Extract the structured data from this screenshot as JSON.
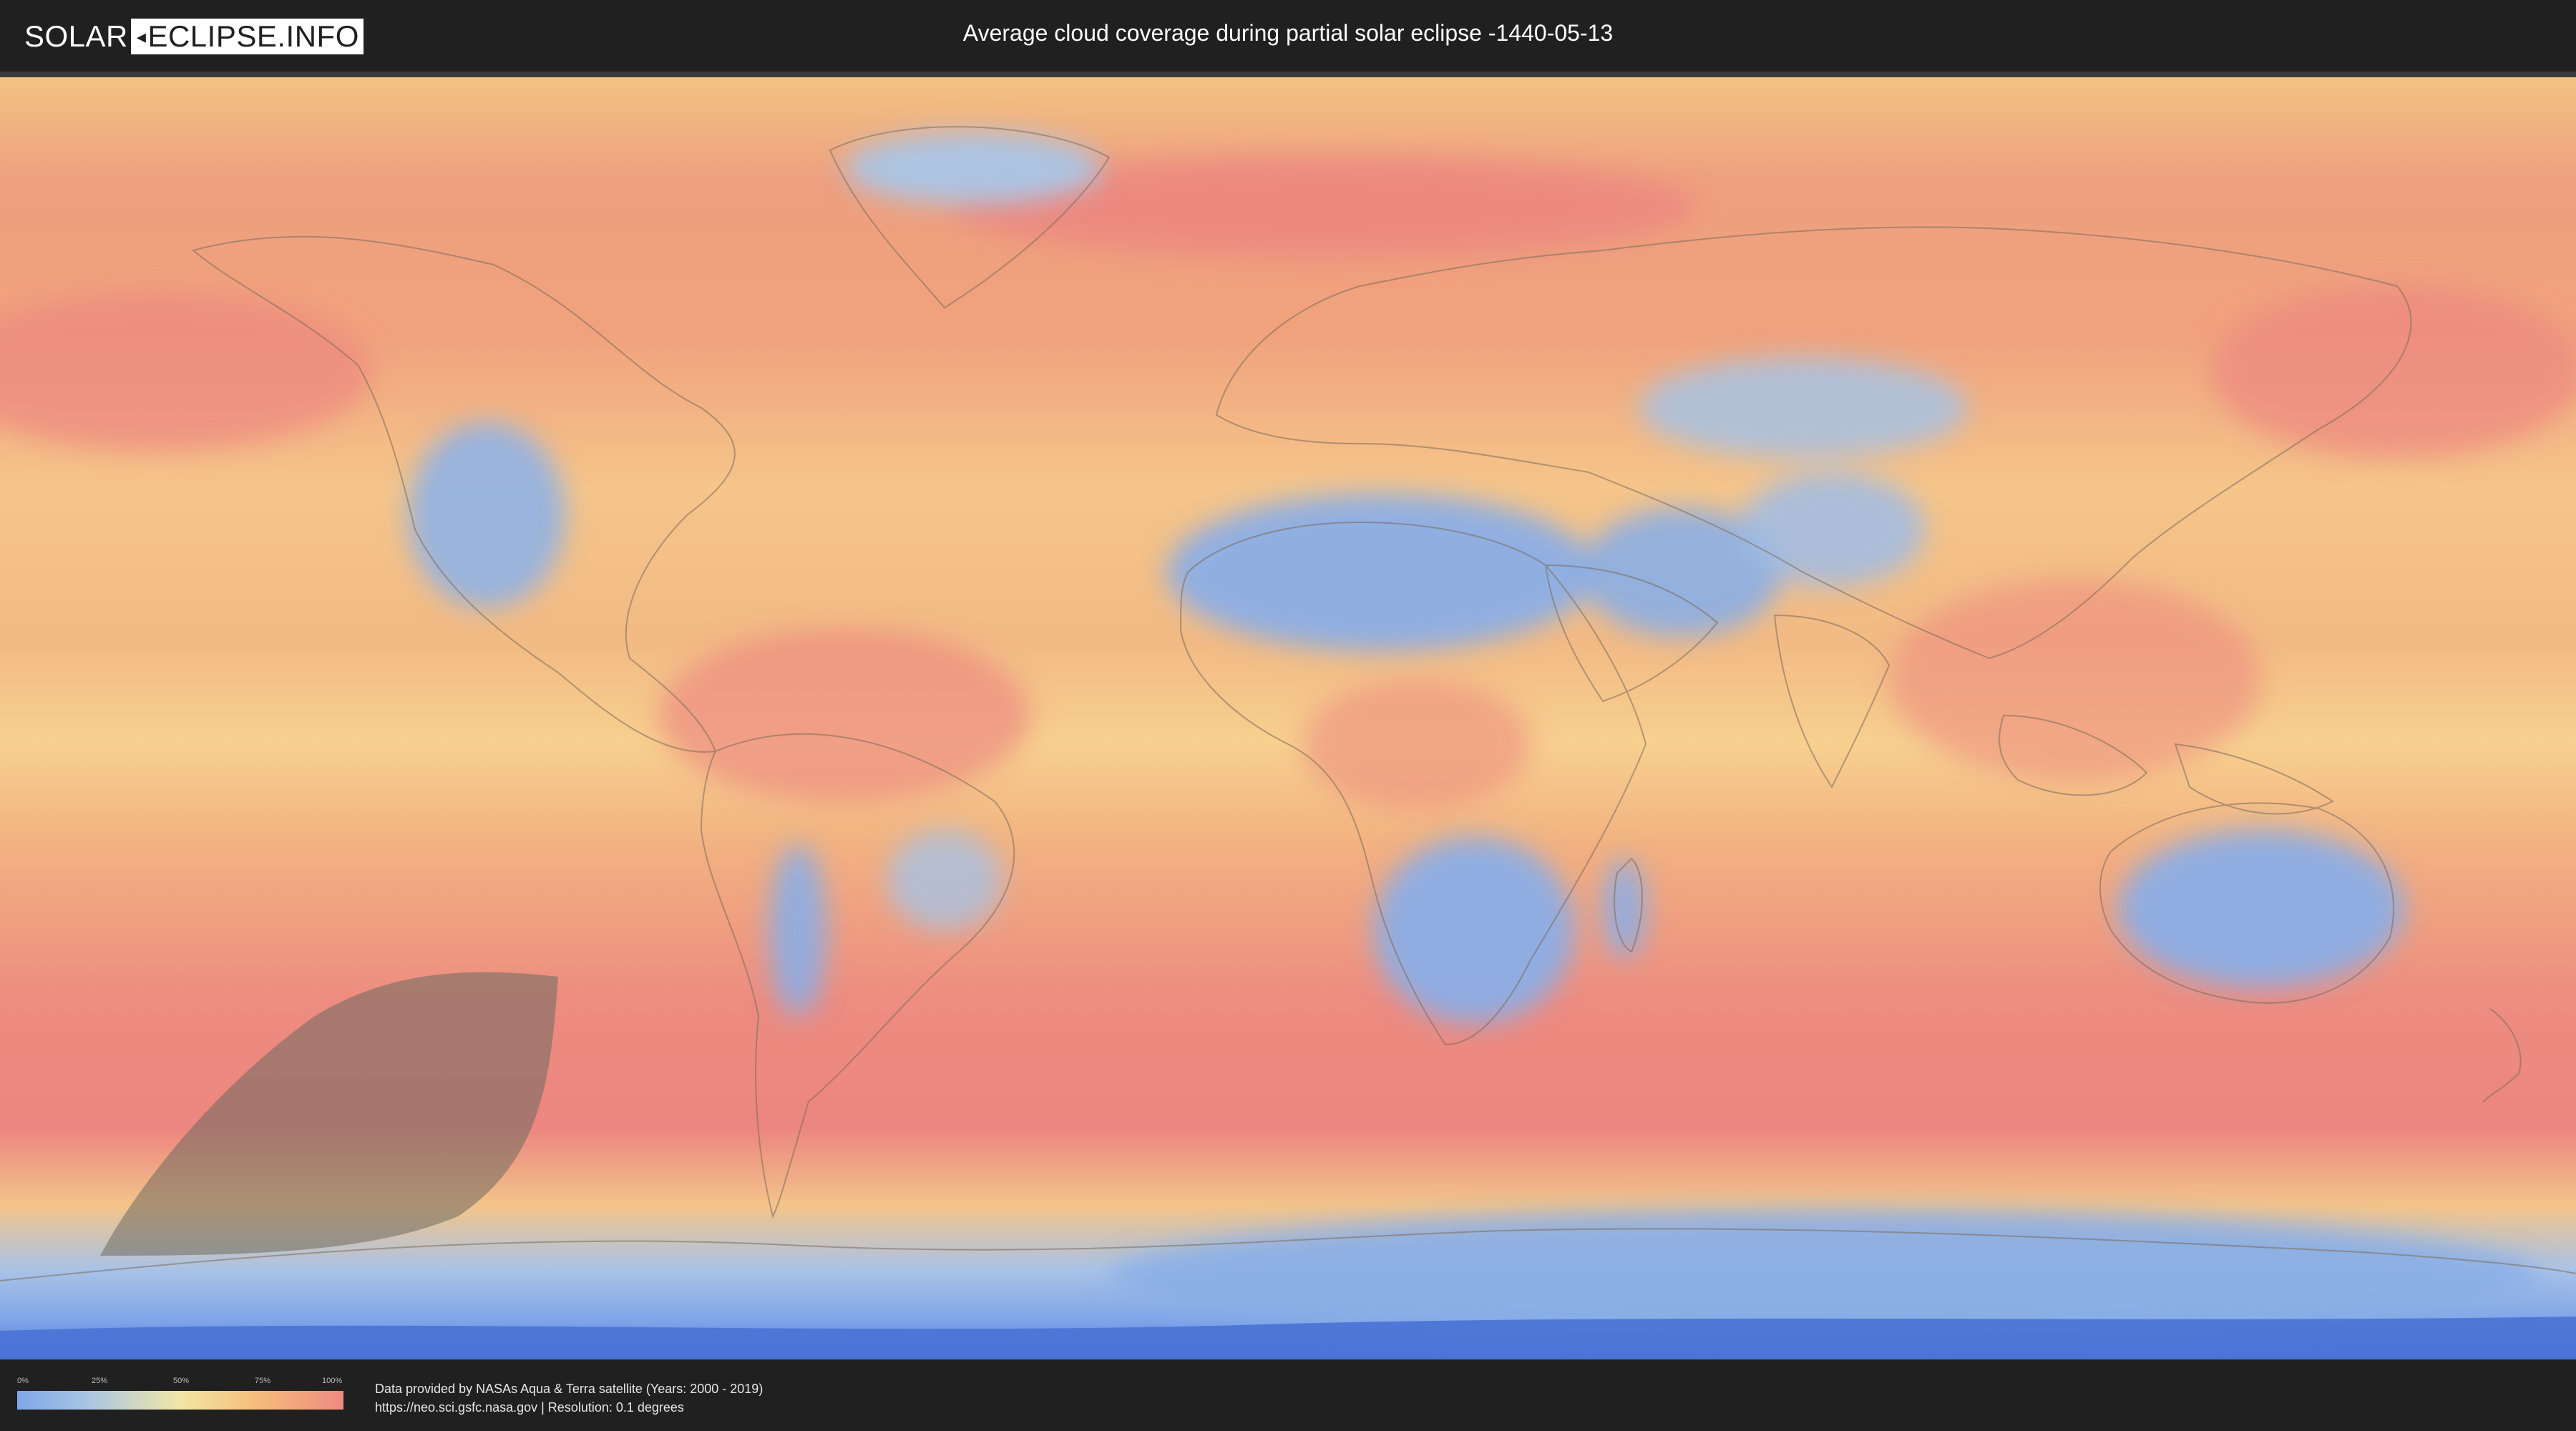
{
  "header": {
    "logo_left": "SOLAR",
    "logo_right": "ECLIPSE.INFO",
    "title": "Average cloud coverage during partial solar eclipse -1440-05-13"
  },
  "map": {
    "description_colors": {
      "low": "#7ea7e8",
      "mid_low": "#a9c6e3",
      "mid": "#f2e6a6",
      "mid_high": "#f5bf7c",
      "high": "#ee8a80"
    },
    "eclipse_zone_color": "#6e6a5f",
    "dark_ocean_band_color": "#3f6fd8"
  },
  "legend": {
    "ticks": [
      "0%",
      "25%",
      "50%",
      "75%",
      "100%"
    ],
    "tick_positions": [
      0,
      0.25,
      0.5,
      0.75,
      1.0
    ]
  },
  "credits": {
    "line1": "Data provided by NASAs Aqua & Terra satellite (Years: 2000 - 2019)",
    "line2": "https://neo.sci.gsfc.nasa.gov | Resolution: 0.1 degrees"
  }
}
